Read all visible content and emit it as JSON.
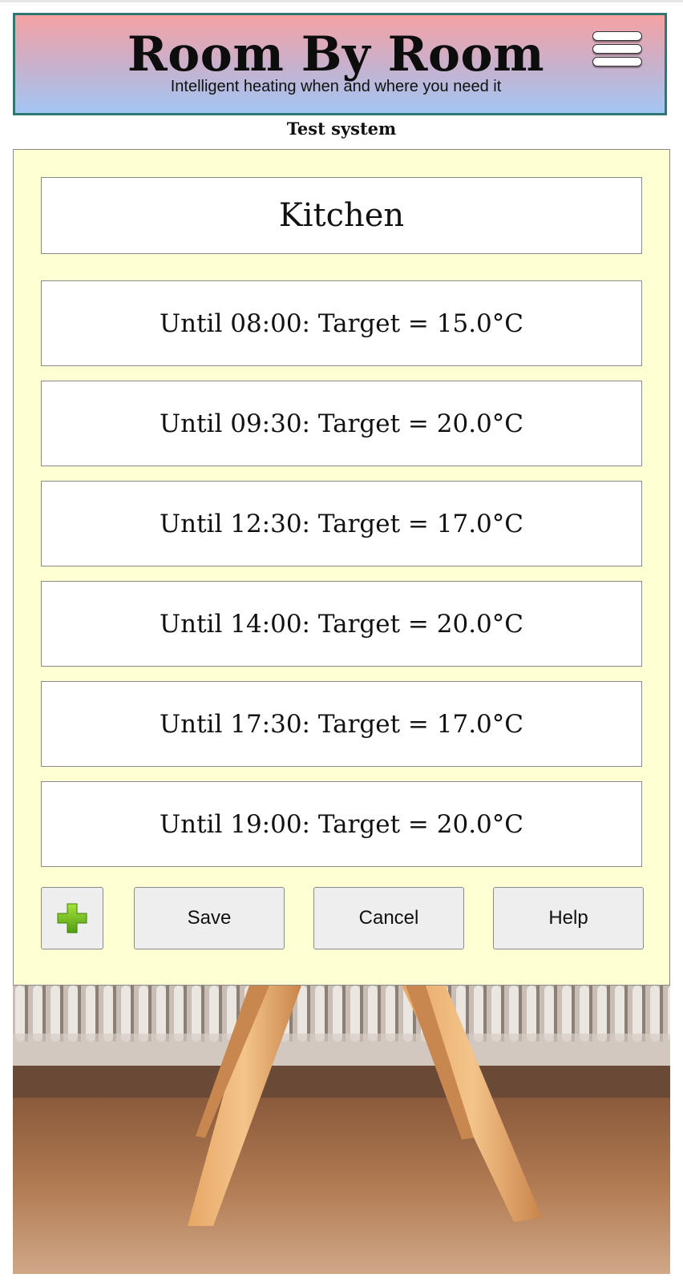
{
  "header": {
    "title": "Room By Room",
    "subtitle": "Intelligent heating when and where you need it",
    "menu_icon": "hamburger-menu-icon"
  },
  "system_name": "Test system",
  "room": {
    "name": "Kitchen"
  },
  "schedule": [
    {
      "label": "Until 08:00: Target = 15.0°C"
    },
    {
      "label": "Until 09:30: Target = 20.0°C"
    },
    {
      "label": "Until 12:30: Target = 17.0°C"
    },
    {
      "label": "Until 14:00: Target = 20.0°C"
    },
    {
      "label": "Until 17:30: Target = 17.0°C"
    },
    {
      "label": "Until 19:00: Target = 20.0°C"
    }
  ],
  "buttons": {
    "add_icon": "green-plus-icon",
    "save": "Save",
    "cancel": "Cancel",
    "help": "Help"
  },
  "colors": {
    "panel_bg": "#ffffd4",
    "header_border": "#2f7770",
    "header_gradient_top": "#f6a2a4",
    "header_gradient_bottom": "#a3c6f4",
    "add_icon_green": "#6cc01a"
  }
}
